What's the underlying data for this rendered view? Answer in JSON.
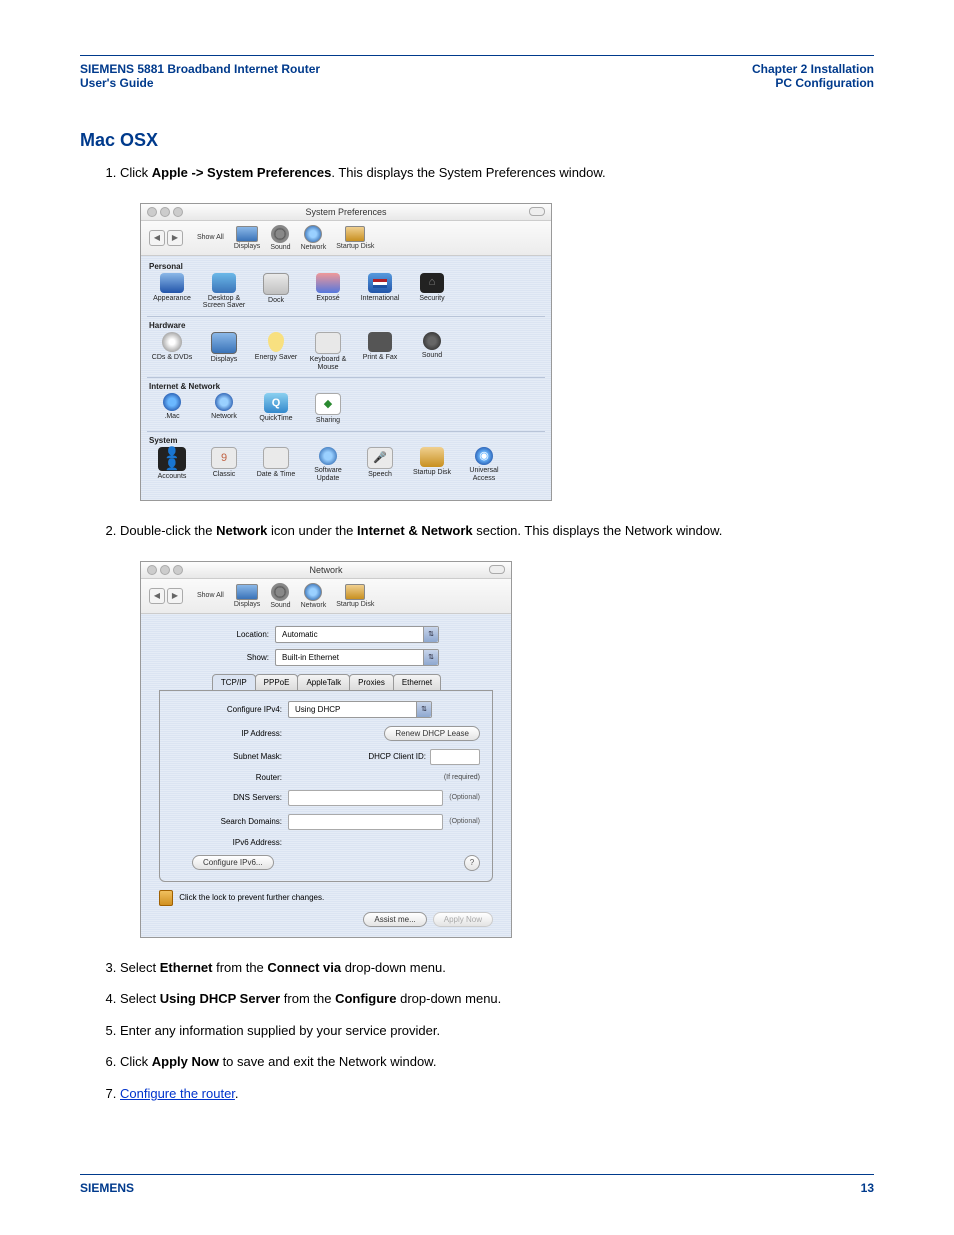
{
  "header": {
    "product_title": "SIEMENS 5881 Broadband Internet Router",
    "doc_type": "User's Guide",
    "chapter": "Chapter 2  Installation",
    "section": "PC Configuration"
  },
  "section_title": "Mac OSX",
  "steps_a": {
    "1": {
      "pre": "Click ",
      "b1": "Apple -> System Preferences",
      "post": ". This displays the System Preferences window."
    },
    "2": {
      "pre": "Double-click the ",
      "b1": "Network",
      "mid": " icon under the ",
      "b2": "Internet & Network",
      "post": " section. This displays the Network window."
    }
  },
  "steps_b": {
    "3": {
      "pre": "Select ",
      "b1": "Ethernet",
      "mid": " from the ",
      "b2": "Connect via",
      "post": " drop-down menu."
    },
    "4": {
      "pre": "Select ",
      "b1": "Using DHCP Server",
      "mid": " from the ",
      "b2": "Configure",
      "post": " drop-down menu."
    },
    "5": {
      "text": "Enter any information supplied by your service provider."
    },
    "6": {
      "pre": "Click ",
      "b1": "Apply Now",
      "post": " to save and exit the Network window."
    },
    "7": {
      "link": "Configure the router",
      "post": "."
    }
  },
  "sysprefs": {
    "title": "System Preferences",
    "toolbar": {
      "show_all": "Show All",
      "displays": "Displays",
      "sound": "Sound",
      "network": "Network",
      "startup": "Startup Disk"
    },
    "cats": {
      "personal": "Personal",
      "hardware": "Hardware",
      "inet": "Internet & Network",
      "system": "System"
    },
    "items": {
      "appearance": "Appearance",
      "desktop": "Desktop & Screen Saver",
      "dock": "Dock",
      "expose": "Exposé",
      "intl": "International",
      "security": "Security",
      "cds": "CDs & DVDs",
      "displays": "Displays",
      "energy": "Energy Saver",
      "kbm": "Keyboard & Mouse",
      "pf": "Print & Fax",
      "sound": "Sound",
      "mac": ".Mac",
      "network": "Network",
      "qt": "QuickTime",
      "sharing": "Sharing",
      "accounts": "Accounts",
      "classic": "Classic",
      "dt": "Date & Time",
      "sw": "Software Update",
      "speech": "Speech",
      "sd": "Startup Disk",
      "ua": "Universal Access"
    }
  },
  "network": {
    "title": "Network",
    "toolbar": {
      "show_all": "Show All",
      "displays": "Displays",
      "sound": "Sound",
      "network": "Network",
      "startup": "Startup Disk"
    },
    "location_label": "Location:",
    "location_value": "Automatic",
    "show_label": "Show:",
    "show_value": "Built-in Ethernet",
    "tabs": {
      "tcpip": "TCP/IP",
      "pppoe": "PPPoE",
      "appletalk": "AppleTalk",
      "proxies": "Proxies",
      "ethernet": "Ethernet"
    },
    "configure_label": "Configure IPv4:",
    "configure_value": "Using DHCP",
    "ip_label": "IP Address:",
    "renew_btn": "Renew DHCP Lease",
    "subnet_label": "Subnet Mask:",
    "client_label": "DHCP Client ID:",
    "router_label": "Router:",
    "if_required": "(If required)",
    "dns_label": "DNS Servers:",
    "search_label": "Search Domains:",
    "ipv6_label": "IPv6 Address:",
    "optional": "(Optional)",
    "config_ipv6_btn": "Configure IPv6...",
    "lock_text": "Click the lock to prevent further changes.",
    "assist_btn": "Assist me...",
    "apply_btn": "Apply Now"
  },
  "footer": {
    "brand": "SIEMENS",
    "page": "13"
  }
}
